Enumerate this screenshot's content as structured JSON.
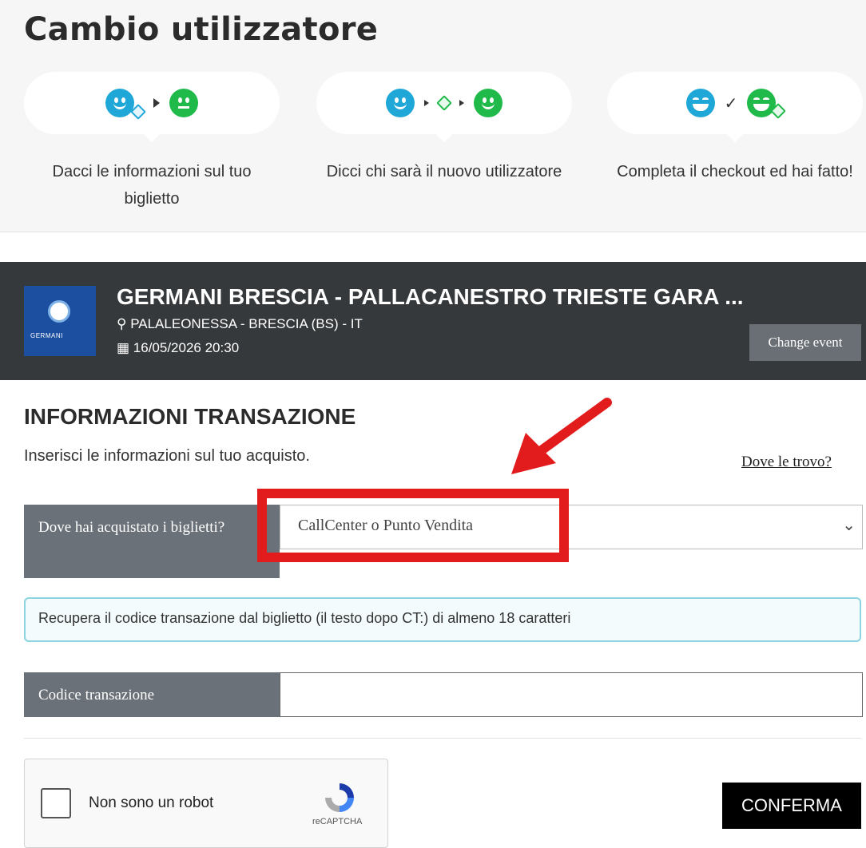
{
  "page": {
    "title": "Cambio utilizzatore"
  },
  "steps": [
    {
      "text": "Dacci le informazioni sul tuo biglietto"
    },
    {
      "text": "Dicci chi sarà il nuovo utilizzatore"
    },
    {
      "text": "Completa il checkout ed hai fatto!"
    }
  ],
  "event": {
    "logo_text": "GERMANI",
    "title": "GERMANI BRESCIA - PALLACANESTRO TRIESTE GARA ...",
    "location": "PALALEONESSA - BRESCIA (BS) - IT",
    "datetime": "16/05/2026 20:30",
    "change_label": "Change event",
    "location_icon": "map-marker",
    "date_icon": "calendar"
  },
  "transaction": {
    "title": "INFORMAZIONI TRANSAZIONE",
    "subtitle": "Inserisci le informazioni sul tuo acquisto.",
    "where_link": "Dove le trovo?",
    "purchase_label": "Dove hai acquistato i biglietti?",
    "purchase_value": "CallCenter o Punto Vendita",
    "info_text": "Recupera il codice transazione dal biglietto (il testo dopo CT:) di almeno 18 caratteri",
    "code_label": "Codice transazione",
    "code_value": ""
  },
  "captcha": {
    "label": "Non sono un robot",
    "brand": "reCAPTCHA"
  },
  "confirm_label": "CONFERMA",
  "colors": {
    "highlight": "#e21c1c",
    "blue_face": "#1fa7d8",
    "green_face": "#1fba4a",
    "event_bg": "#36393b"
  }
}
